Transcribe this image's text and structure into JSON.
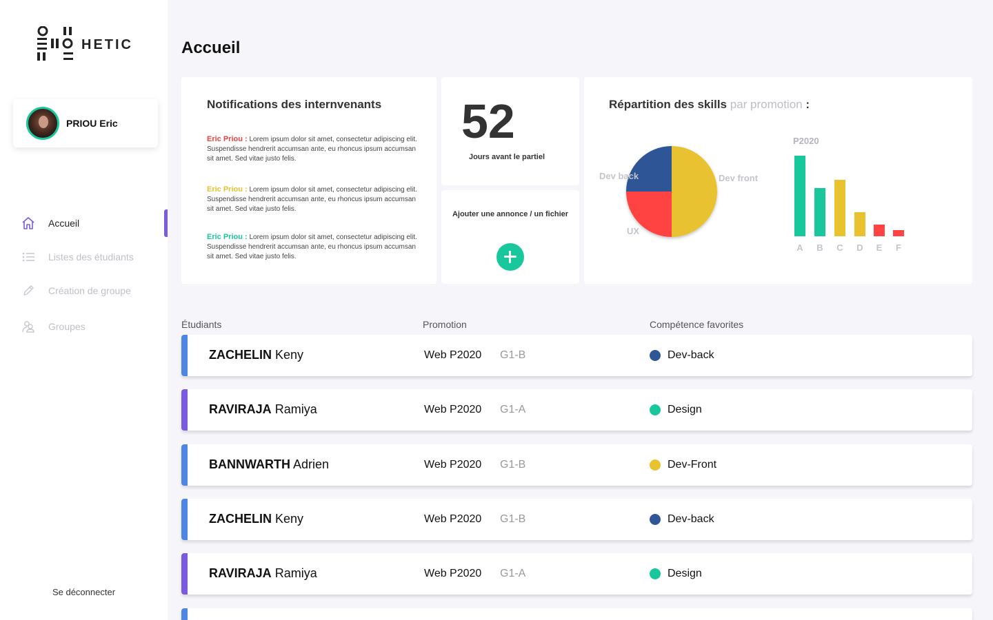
{
  "brand": {
    "name": "HETIC"
  },
  "profile": {
    "name": "PRIOU Eric"
  },
  "nav": {
    "items": [
      {
        "label": "Accueil",
        "icon": "home-icon",
        "active": true
      },
      {
        "label": "Listes des étudiants",
        "icon": "list-icon",
        "active": false
      },
      {
        "label": "Création de groupe",
        "icon": "pencil-icon",
        "active": false
      },
      {
        "label": "Groupes",
        "icon": "users-icon",
        "active": false
      }
    ],
    "logout": "Se déconnecter"
  },
  "page": {
    "title": "Accueil"
  },
  "notifications": {
    "title": "Notifications des internvenants",
    "items": [
      {
        "author": "Eric Priou :",
        "color": "#f04040",
        "text": "Lorem ipsum dolor sit amet, consectetur adipiscing elit. Suspendisse hendrerit accumsan ante, eu rhoncus ipsum accumsan sit amet. Sed vitae justo felis."
      },
      {
        "author": "Eric Priou :",
        "color": "#e9c230",
        "text": "Lorem ipsum dolor sit amet, consectetur adipiscing elit. Suspendisse hendrerit accumsan ante, eu rhoncus ipsum accumsan sit amet. Sed vitae justo felis."
      },
      {
        "author": "Eric Priou :",
        "color": "#18c79c",
        "text": "Lorem ipsum dolor sit amet, consectetur adipiscing elit. Suspendisse hendrerit accumsan ante, eu rhoncus ipsum accumsan sit amet. Sed vitae justo felis."
      }
    ]
  },
  "countdown": {
    "value": "52",
    "label": "Jours avant le partiel"
  },
  "announce": {
    "label": "Ajouter une annonce / un fichier"
  },
  "skills": {
    "title": "Répartition des skills",
    "title_muted": "par promotion",
    "title_suffix": ":"
  },
  "chart_data": [
    {
      "type": "pie",
      "slices": [
        {
          "label": "Dev front",
          "value": 50,
          "color": "#e9c230"
        },
        {
          "label": "UX",
          "value": 25,
          "color": "#ff4343"
        },
        {
          "label": "Dev back",
          "value": 25,
          "color": "#2f5797"
        }
      ]
    },
    {
      "type": "bar",
      "title": "P2020",
      "categories": [
        "A",
        "B",
        "C",
        "D",
        "E",
        "F"
      ],
      "values": [
        117,
        70,
        82,
        35,
        17,
        9
      ],
      "colors": [
        "#18c79c",
        "#18c79c",
        "#e9c230",
        "#e9c230",
        "#ff4343",
        "#ff4343"
      ]
    }
  ],
  "table": {
    "headers": {
      "student": "Étudiants",
      "promotion": "Promotion",
      "skills": "Compétence favorites"
    },
    "rows": [
      {
        "last": "ZACHELIN",
        "first": "Keny",
        "promo": "Web P2020",
        "group": "G1-B",
        "skill": "Dev-back",
        "skill_color": "#2f5797",
        "accent": "#4e86e4"
      },
      {
        "last": "RAVIRAJA",
        "first": "Ramiya",
        "promo": "Web P2020",
        "group": "G1-A",
        "skill": "Design",
        "skill_color": "#18c79c",
        "accent": "#7a5be0"
      },
      {
        "last": "BANNWARTH",
        "first": "Adrien",
        "promo": "Web P2020",
        "group": "G1-B",
        "skill": "Dev-Front",
        "skill_color": "#e9c230",
        "accent": "#4e86e4"
      },
      {
        "last": "ZACHELIN",
        "first": "Keny",
        "promo": "Web P2020",
        "group": "G1-B",
        "skill": "Dev-back",
        "skill_color": "#2f5797",
        "accent": "#4e86e4"
      },
      {
        "last": "RAVIRAJA",
        "first": "Ramiya",
        "promo": "Web P2020",
        "group": "G1-A",
        "skill": "Design",
        "skill_color": "#18c79c",
        "accent": "#7a5be0"
      },
      {
        "last": "",
        "first": "",
        "promo": "",
        "group": "",
        "skill": "",
        "skill_color": "#ffffff",
        "accent": "#4e86e4"
      }
    ]
  }
}
